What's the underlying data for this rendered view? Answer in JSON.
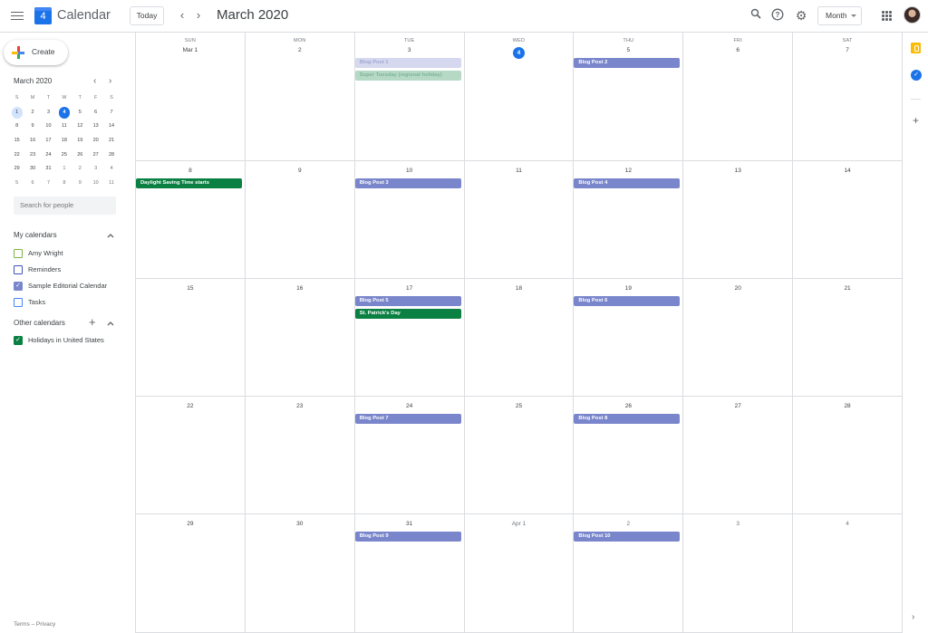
{
  "header": {
    "menu_icon": "hamburger-menu-icon",
    "logo_day": "4",
    "app_title": "Calendar",
    "today_label": "Today",
    "prev_icon": "chevron-left-icon",
    "next_icon": "chevron-right-icon",
    "prev_glyph": "‹",
    "next_glyph": "›",
    "period_title": "March 2020",
    "search_glyph": "⚲",
    "help_glyph": "?",
    "settings_glyph": "⚙",
    "view_select": "Month"
  },
  "sidebar": {
    "create_label": "Create",
    "mini_month": {
      "title": "March 2020",
      "prev_glyph": "‹",
      "next_glyph": "›",
      "weekdays": [
        "S",
        "M",
        "T",
        "W",
        "T",
        "F",
        "S"
      ],
      "weeks": [
        [
          {
            "d": "1",
            "s": "sel"
          },
          {
            "d": "2"
          },
          {
            "d": "3"
          },
          {
            "d": "4",
            "s": "today"
          },
          {
            "d": "5"
          },
          {
            "d": "6"
          },
          {
            "d": "7"
          }
        ],
        [
          {
            "d": "8"
          },
          {
            "d": "9"
          },
          {
            "d": "10"
          },
          {
            "d": "11"
          },
          {
            "d": "12"
          },
          {
            "d": "13"
          },
          {
            "d": "14"
          }
        ],
        [
          {
            "d": "15"
          },
          {
            "d": "16"
          },
          {
            "d": "17"
          },
          {
            "d": "18"
          },
          {
            "d": "19"
          },
          {
            "d": "20"
          },
          {
            "d": "21"
          }
        ],
        [
          {
            "d": "22"
          },
          {
            "d": "23"
          },
          {
            "d": "24"
          },
          {
            "d": "25"
          },
          {
            "d": "26"
          },
          {
            "d": "27"
          },
          {
            "d": "28"
          }
        ],
        [
          {
            "d": "29"
          },
          {
            "d": "30"
          },
          {
            "d": "31"
          },
          {
            "d": "1",
            "s": "other"
          },
          {
            "d": "2",
            "s": "other"
          },
          {
            "d": "3",
            "s": "other"
          },
          {
            "d": "4",
            "s": "other"
          }
        ],
        [
          {
            "d": "5",
            "s": "other"
          },
          {
            "d": "6",
            "s": "other"
          },
          {
            "d": "7",
            "s": "other"
          },
          {
            "d": "8",
            "s": "other"
          },
          {
            "d": "9",
            "s": "other"
          },
          {
            "d": "10",
            "s": "other"
          },
          {
            "d": "11",
            "s": "other"
          }
        ]
      ]
    },
    "search_placeholder": "Search for people",
    "my_calendars_title": "My calendars",
    "my_calendars": [
      {
        "name": "Amy Wright",
        "color": "#33b679",
        "border": "#7cb342",
        "checked": false
      },
      {
        "name": "Reminders",
        "color": "#3f51b5",
        "border": "#3f51b5",
        "checked": false
      },
      {
        "name": "Sample Editorial Calendar",
        "color": "#7986cb",
        "border": "#7986cb",
        "checked": true
      },
      {
        "name": "Tasks",
        "color": "#4285f4",
        "border": "#4285f4",
        "checked": false
      }
    ],
    "other_calendars_title": "Other calendars",
    "other_calendars": [
      {
        "name": "Holidays in United States",
        "color": "#0b8043",
        "border": "#0b8043",
        "checked": true
      }
    ],
    "chevron_up_glyph": "^",
    "add_glyph": "+",
    "check_glyph": "✓",
    "footer": "Terms – Privacy"
  },
  "month_grid": {
    "weekdays": [
      "SUN",
      "MON",
      "TUE",
      "WED",
      "THU",
      "FRI",
      "SAT"
    ],
    "weeks": [
      [
        {
          "label": "Mar 1",
          "events": []
        },
        {
          "label": "2",
          "events": []
        },
        {
          "label": "3",
          "events": [
            {
              "title": "Blog Post 1",
              "color": "#d5d8ef",
              "text": "#a2a8d3"
            },
            {
              "title": "Super Tuesday (regional holiday)",
              "color": "#b6d9c6",
              "text": "#7fb497"
            }
          ]
        },
        {
          "label": "4",
          "today": true,
          "events": []
        },
        {
          "label": "5",
          "events": [
            {
              "title": "Blog Post 2",
              "color": "#7986cb",
              "text": "#ffffff"
            }
          ]
        },
        {
          "label": "6",
          "events": []
        },
        {
          "label": "7",
          "events": []
        }
      ],
      [
        {
          "label": "8",
          "events": [
            {
              "title": "Daylight Saving Time starts",
              "color": "#0b8043",
              "text": "#ffffff"
            }
          ]
        },
        {
          "label": "9",
          "events": []
        },
        {
          "label": "10",
          "events": [
            {
              "title": "Blog Post 3",
              "color": "#7986cb",
              "text": "#ffffff"
            }
          ]
        },
        {
          "label": "11",
          "events": []
        },
        {
          "label": "12",
          "events": [
            {
              "title": "Blog Post 4",
              "color": "#7986cb",
              "text": "#ffffff"
            }
          ]
        },
        {
          "label": "13",
          "events": []
        },
        {
          "label": "14",
          "events": []
        }
      ],
      [
        {
          "label": "15",
          "events": []
        },
        {
          "label": "16",
          "events": []
        },
        {
          "label": "17",
          "events": [
            {
              "title": "Blog Post 5",
              "color": "#7986cb",
              "text": "#ffffff"
            },
            {
              "title": "St. Patrick's Day",
              "color": "#0b8043",
              "text": "#ffffff"
            }
          ]
        },
        {
          "label": "18",
          "events": []
        },
        {
          "label": "19",
          "events": [
            {
              "title": "Blog Post 6",
              "color": "#7986cb",
              "text": "#ffffff"
            }
          ]
        },
        {
          "label": "20",
          "events": []
        },
        {
          "label": "21",
          "events": []
        }
      ],
      [
        {
          "label": "22",
          "events": []
        },
        {
          "label": "23",
          "events": []
        },
        {
          "label": "24",
          "events": [
            {
              "title": "Blog Post 7",
              "color": "#7986cb",
              "text": "#ffffff"
            }
          ]
        },
        {
          "label": "25",
          "events": []
        },
        {
          "label": "26",
          "events": [
            {
              "title": "Blog Post 8",
              "color": "#7986cb",
              "text": "#ffffff"
            }
          ]
        },
        {
          "label": "27",
          "events": []
        },
        {
          "label": "28",
          "events": []
        }
      ],
      [
        {
          "label": "29",
          "events": []
        },
        {
          "label": "30",
          "events": []
        },
        {
          "label": "31",
          "events": [
            {
              "title": "Blog Post 9",
              "color": "#7986cb",
              "text": "#ffffff"
            }
          ]
        },
        {
          "label": "Apr 1",
          "other": true,
          "events": []
        },
        {
          "label": "2",
          "other": true,
          "events": [
            {
              "title": "Blog Post 10",
              "color": "#7986cb",
              "text": "#ffffff"
            }
          ]
        },
        {
          "label": "3",
          "other": true,
          "events": []
        },
        {
          "label": "4",
          "other": true,
          "events": []
        }
      ]
    ]
  },
  "right_rail": {
    "items": [
      "keep-icon",
      "tasks-icon",
      "add-addon-icon"
    ],
    "tasks_glyph": "✓",
    "add_glyph": "+",
    "expand_glyph": "›"
  },
  "colors": {
    "accent": "#1a73e8",
    "editorial": "#7986cb",
    "holiday": "#0b8043",
    "grid_line": "#dadce0"
  }
}
